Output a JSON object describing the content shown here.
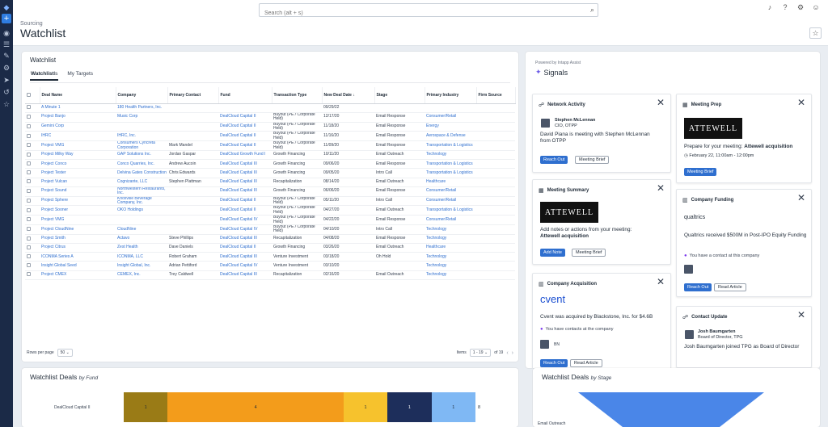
{
  "topbar": {
    "search_placeholder": "Search (alt + s)",
    "breadcrumb": "Sourcing",
    "page_title": "Watchlist"
  },
  "watchlist": {
    "title": "Watchlist",
    "tabs": [
      "Watchlist",
      "My Targets"
    ],
    "tab_fragment": "ls",
    "columns": [
      "Deal Name",
      "Company",
      "Primary Contact",
      "Fund",
      "Transaction Type",
      "New Deal Date",
      "Stage",
      "Primary Industry",
      "Firm Source"
    ],
    "rows": [
      [
        "A Minute 1",
        "180 Health Partners, Inc.",
        "",
        "",
        "",
        "09/29/22",
        "",
        "",
        ""
      ],
      [
        "Project Banjo",
        "Music Corp",
        "",
        "DealCloud Capital II",
        "Buyout (PE / Corporate Held)",
        "12/17/20",
        "Email Response",
        "Consumer/Retail",
        ""
      ],
      [
        "Gemini Corp",
        "",
        "",
        "DealCloud Capital II",
        "Buyout (PE / Corporate Held)",
        "11/18/20",
        "Email Response",
        "Energy",
        ""
      ],
      [
        "IHRC",
        "IHRC, Inc.",
        "",
        "DealCloud Capital II",
        "Buyout (PE / Corporate Held)",
        "11/16/20",
        "Email Response",
        "Aerospace & Defense",
        ""
      ],
      [
        "Project VMG",
        "Consumers Cyncreta Corporation",
        "Mark Mandel",
        "DealCloud Capital II",
        "Buyout (PE / Corporate Held)",
        "11/09/20",
        "Email Response",
        "Transportation & Logistics",
        ""
      ],
      [
        "Project Milky Way",
        "GAP Solutions Inc.",
        "Jordan Gaspar",
        "DealCloud Growth Fund I",
        "Growth Financing",
        "10/11/20",
        "Email Outreach",
        "Technology",
        ""
      ],
      [
        "Project Conco",
        "Conco Quarries, Inc.",
        "Andrew Aucoin",
        "DealCloud Capital III",
        "Growth Financing",
        "09/06/20",
        "Email Response",
        "Transportation & Logistics",
        ""
      ],
      [
        "Project Tester",
        "Delvina Gates Construction",
        "Chris Edwards",
        "DealCloud Capital III",
        "Growth Financing",
        "09/05/20",
        "Intro Call",
        "Transportation & Logistics",
        ""
      ],
      [
        "Project Vulcan",
        "Cognizante, LLC",
        "Stephen Plattman",
        "DealCloud Capital III",
        "Recapitalization",
        "08/14/20",
        "Email Outreach",
        "Healthcare",
        ""
      ],
      [
        "Project Sound",
        "Northwestern Restaurants, Inc.",
        "",
        "DealCloud Capital III",
        "Growth Financing",
        "06/06/20",
        "Email Response",
        "Consumer/Retail",
        ""
      ],
      [
        "Project Sphere",
        "Knoxville Beverage Company, Inc.",
        "",
        "DealCloud Capital II",
        "Buyout (PE / Corporate Held)",
        "05/11/20",
        "Intro Call",
        "Consumer/Retail",
        ""
      ],
      [
        "Project Sooner",
        "OKO Holdings",
        "",
        "DealCloud Capital II",
        "Buyout (PE / Corporate Held)",
        "04/27/20",
        "Email Outreach",
        "Transportation & Logistics",
        ""
      ],
      [
        "Project VMG",
        "",
        "",
        "DealCloud Capital IV",
        "Buyout (PE / Corporate Held)",
        "04/22/20",
        "Email Response",
        "Consumer/Retail",
        ""
      ],
      [
        "Project CloudNine",
        "CloudNine",
        "",
        "DealCloud Capital IV",
        "Buyout (PE / Corporate Held)",
        "04/10/20",
        "Intro Call",
        "Technology",
        ""
      ],
      [
        "Project Smith",
        "Actavo",
        "Steve Phillips",
        "DealCloud Capital III",
        "Recapitalization",
        "04/08/20",
        "Email Response",
        "Technology",
        ""
      ],
      [
        "Project Citrus",
        "Zest Health",
        "Dave Daniels",
        "DealCloud Capital II",
        "Growth Financing",
        "03/26/20",
        "Email Outreach",
        "Healthcare",
        ""
      ],
      [
        "ICONMA Series A",
        "ICONMA, LLC",
        "Robert Graham",
        "DealCloud Capital III",
        "Venture Investment",
        "03/18/20",
        "Oh Hold",
        "Technology",
        ""
      ],
      [
        "Insight Global Seed",
        "Insight Global, Inc.",
        "Adrian Pettiford",
        "DealCloud Capital IV",
        "Venture Investment",
        "03/10/20",
        "",
        "Technology",
        ""
      ],
      [
        "Project CMEX",
        "CEMEX, Inc.",
        "Trey Caldwell",
        "DealCloud Capital III",
        "Recapitalization",
        "02/16/20",
        "Email Outreach",
        "Technology",
        ""
      ]
    ],
    "rows_per_page_label": "Rows per page",
    "rows_per_page_value": "50",
    "items_label": "Items",
    "items_range": "1 - 19",
    "items_total": "of 19"
  },
  "signals": {
    "powered_by": "Powered by Intapp Assist",
    "title": "Signals",
    "network_activity": {
      "title": "Network Activity",
      "person_name": "Stephen McLennan",
      "person_role": "CIO, OTPP",
      "text": "David Piana is meeting with Stephen McLennan from OTPP",
      "btn_reach": "Reach Out",
      "btn_brief": "Meeting Brief"
    },
    "meeting_prep": {
      "title": "Meeting Prep",
      "logo": "ATTEWELL",
      "text_prefix": "Prepare for your meeting:",
      "text_bold": "Attewell acquisition",
      "time": "February 22, 11:00am - 12:00pm",
      "btn_brief": "Meeting Brief"
    },
    "meeting_summary": {
      "title": "Meeting Summary",
      "logo": "ATTEWELL",
      "text_prefix": "Add notes or actions from your meeting:",
      "text_bold": "Attewell acquisition",
      "btn_note": "Add Note",
      "btn_brief": "Meeting Brief"
    },
    "company_funding": {
      "title": "Company Funding",
      "logo": "qualtrics",
      "text": "Qualtrics received $500M in Post-IPO Equity Funding",
      "contact": "You have a contact at this company",
      "btn_reach": "Reach Out",
      "btn_article": "Read Article"
    },
    "company_acquisition": {
      "title": "Company Acquisition",
      "logo": "cvent",
      "text": "Cvent was acquired by Blackstone, Inc. for $4.6B",
      "contact": "You have contacts at the company",
      "initials": "BN",
      "btn_reach": "Reach Out",
      "btn_article": "Read Article"
    },
    "contact_update": {
      "title": "Contact Update",
      "person_name": "Josh Baumgarten",
      "person_role": "Board of Director, TPG",
      "text": "Josh Baumgarten joined TPG as Board of Director"
    }
  },
  "deals_by_fund": {
    "title": "Watchlist Deals",
    "subtitle": "by Fund",
    "category": "DealCloud Capital II",
    "segments": [
      {
        "value": 1,
        "color": "#9a7b16"
      },
      {
        "value": 4,
        "color": "#f39c1b"
      },
      {
        "value": 1,
        "color": "#f6c22d"
      },
      {
        "value": 1,
        "color": "#1d2e5b"
      },
      {
        "value": 1,
        "color": "#7fb8f4"
      }
    ],
    "segment_labels": [
      "1",
      "4",
      "1",
      "1",
      "1"
    ],
    "total": "8"
  },
  "deals_by_stage": {
    "title": "Watchlist Deals",
    "subtitle": "by Stage",
    "label": "Email Outreach",
    "color": "#4a86e8"
  }
}
